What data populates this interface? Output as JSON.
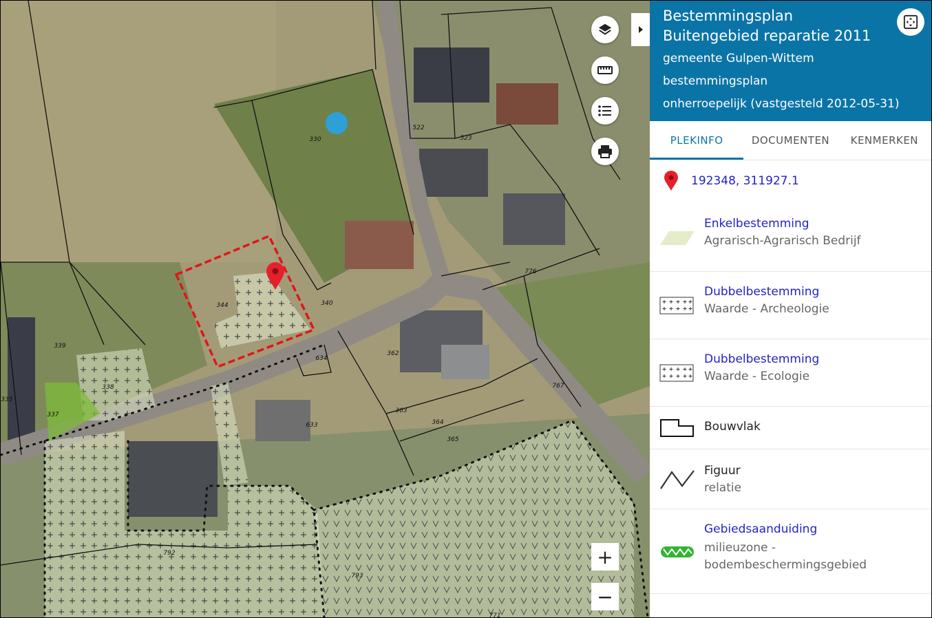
{
  "panel": {
    "title": "Bestemmingsplan Buitengebied reparatie 2011",
    "municipality": "gemeente Gulpen-Wittem",
    "plan_type": "bestemmingsplan",
    "status": "onherroepelijk (vastgesteld 2012-05-31)",
    "tabs": [
      {
        "label": "PLEKINFO",
        "active": true
      },
      {
        "label": "DOCUMENTEN",
        "active": false
      },
      {
        "label": "KENMERKEN",
        "active": false
      }
    ],
    "coordinates": "192348, 311927.1",
    "legend": [
      {
        "title": "Enkelbestemming",
        "subtitle": "Agrarisch-Agrarisch Bedrijf",
        "symbol": "parallelogram-fill"
      },
      {
        "title": "Dubbelbestemming",
        "subtitle": "Waarde - Archeologie",
        "symbol": "cross-grid"
      },
      {
        "title": "Dubbelbestemming",
        "subtitle": "Waarde - Ecologie",
        "symbol": "cross-grid"
      },
      {
        "title": "Bouwvlak",
        "subtitle": "",
        "symbol": "building-outline"
      },
      {
        "title": "Figuur",
        "subtitle": "relatie",
        "symbol": "zigzag-line"
      },
      {
        "title": "Gebiedsaanduiding",
        "subtitle": "milieuzone - bodembeschermingsgebied",
        "symbol": "green-zigzag-band"
      }
    ]
  },
  "map": {
    "parcel_labels": [
      "330",
      "522",
      "523",
      "344",
      "340",
      "339",
      "338",
      "337",
      "335",
      "634",
      "362",
      "363",
      "364",
      "365",
      "633",
      "776",
      "767",
      "792",
      "793",
      "771"
    ],
    "zoom_in_label": "+",
    "zoom_out_label": "−",
    "tools": [
      "layers-icon",
      "ruler-icon",
      "legend-list-icon",
      "print-icon"
    ]
  },
  "colors": {
    "header_bg": "#0b74a7",
    "link": "#2222cc",
    "selection": "#e0161a",
    "agrarisch_fill": "#e4ecc9",
    "milieuzone_green": "#33b533"
  }
}
